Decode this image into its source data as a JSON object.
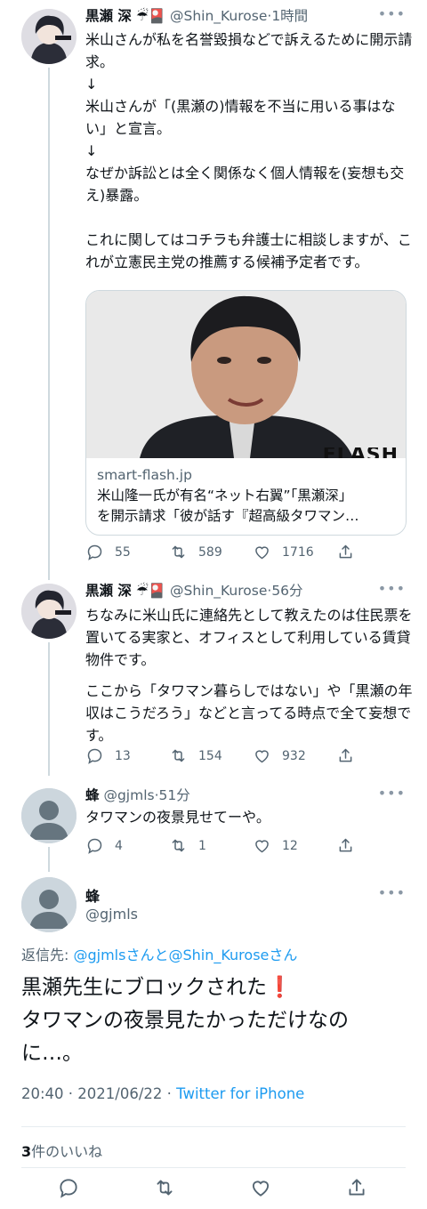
{
  "tweets": [
    {
      "name": "黒瀬 深",
      "emoji": "☔🎴",
      "handle": "@Shin_Kurose",
      "time": "1時間",
      "lines": [
        "米山さんが私を名誉毀損などで訴えるために開示請求。",
        "↓",
        "米山さんが「(黒瀬の)情報を不当に用いる事はない」と宣言。",
        "↓",
        "なぜか訴訟とは全く関係なく個人情報を(妄想も交え)暴露。",
        "",
        "これに関してはコチラも弁護士に相談しますが、これが立憲民主党の推薦する候補予定者です。"
      ],
      "card": {
        "image_label": "FLASH",
        "domain": "smart-flash.jp",
        "title_line1": "米山隆一氏が有名“ネット右翼”「黒瀬深」",
        "title_line2": "を開示請求「彼が話す『超高級タワマン…"
      },
      "replies": "55",
      "retweets": "589",
      "likes": "1716"
    },
    {
      "name": "黒瀬 深",
      "emoji": "☔🎴",
      "handle": "@Shin_Kurose",
      "time": "56分",
      "para1": "ちなみに米山氏に連絡先として教えたのは住民票を置いてる実家と、オフィスとして利用している賃貸物件です。",
      "para2": "ここから「タワマン暮らしではない」や「黒瀬の年収はこうだろう」などと言ってる時点で全て妄想です。",
      "replies": "13",
      "retweets": "154",
      "likes": "932"
    },
    {
      "name": "蜂",
      "handle": "@gjmls",
      "time": "51分",
      "text": "タワマンの夜景見せてーや。",
      "replies": "4",
      "retweets": "1",
      "likes": "12"
    }
  ],
  "main": {
    "name": "蜂",
    "handle": "@gjmls",
    "reply_prefix": "返信先: ",
    "reply_link": "@gjmlsさんと@Shin_Kuroseさん",
    "line1": "黒瀬先生にブロックされた",
    "line1_emoji": "❗",
    "line2": "タワマンの夜景見たかっただけなの",
    "line3": "に…。",
    "time": "20:40 · 2021/06/22 · ",
    "source": "Twitter for iPhone",
    "likes_count": "3",
    "likes_label": "件のいいね"
  },
  "colors": {
    "accent": "#1d9bf0",
    "secondary": "#536471",
    "alert": "#e0245e"
  }
}
